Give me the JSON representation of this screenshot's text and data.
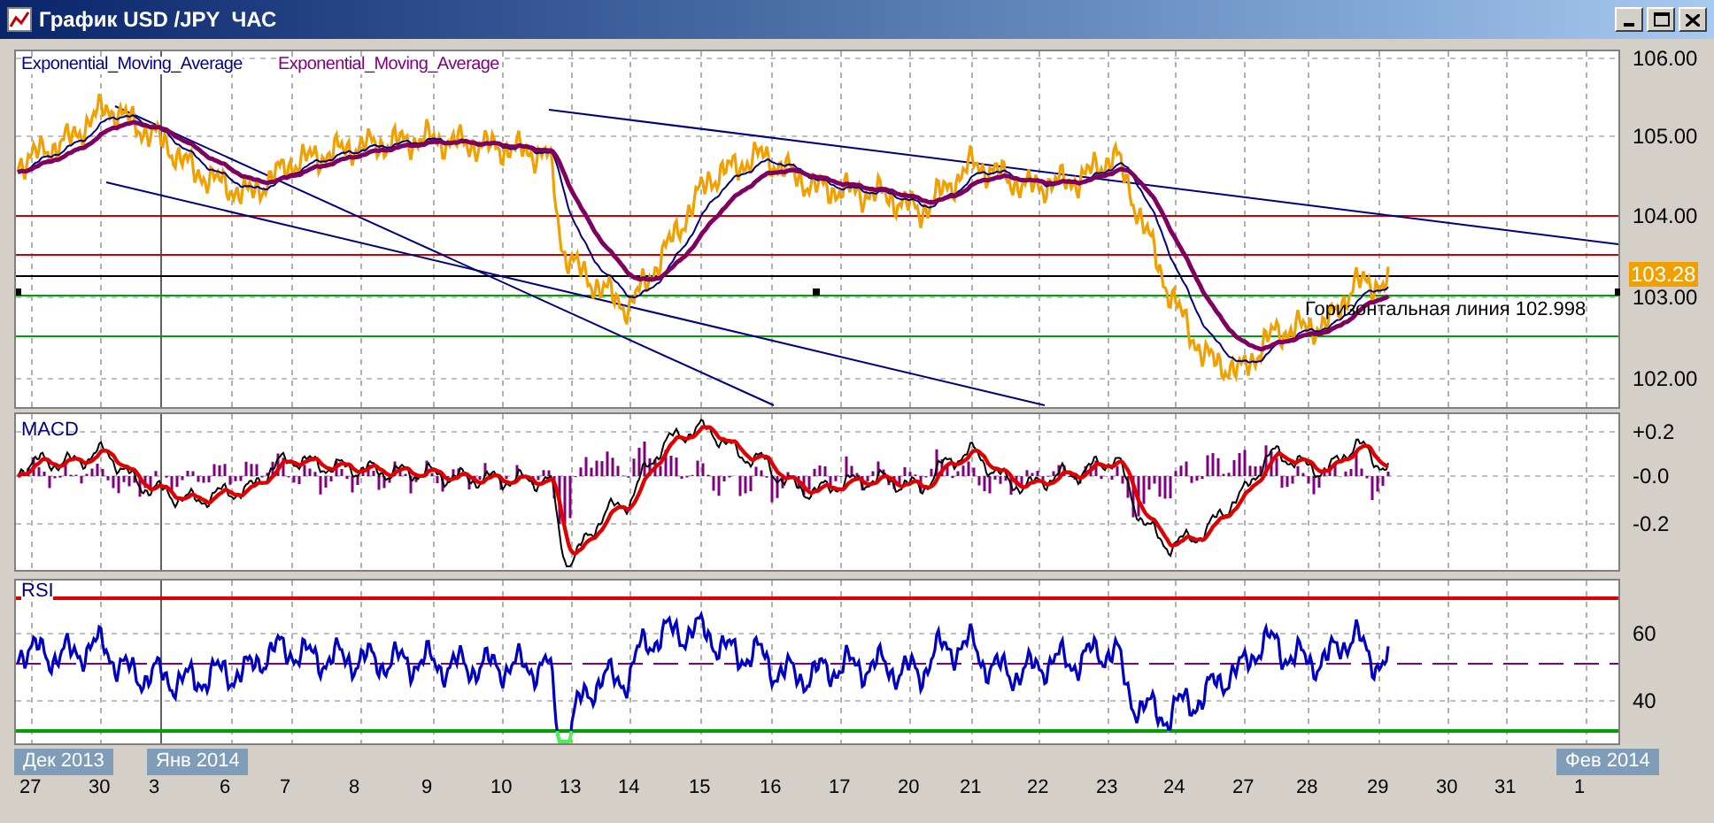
{
  "window": {
    "title": "График USD /JPY  ЧАС"
  },
  "main_panel": {
    "legend": [
      {
        "text": "Exponential_Moving_Average",
        "color": "#000080"
      },
      {
        "text": "Exponential_Moving_Average",
        "color": "#800080"
      }
    ],
    "price_axis": [
      "106.00",
      "105.00",
      "104.00",
      "103.00",
      "102.00"
    ],
    "current_price": "103.28",
    "horizontal_line_label": "Горизонтальная линия 102.998"
  },
  "macd_panel": {
    "label": "MACD",
    "axis": [
      "+0.2",
      "-0.0",
      "-0.2"
    ]
  },
  "rsi_panel": {
    "label": "RSI",
    "axis": [
      "60",
      "40"
    ]
  },
  "time_axis": {
    "months": [
      "Дек 2013",
      "Янв 2014",
      "Фев 2014"
    ],
    "days": [
      "27",
      "30",
      "3",
      "6",
      "7",
      "8",
      "9",
      "10",
      "13",
      "14",
      "15",
      "16",
      "17",
      "20",
      "21",
      "22",
      "23",
      "24",
      "27",
      "28",
      "29",
      "30",
      "31",
      "1"
    ]
  }
}
